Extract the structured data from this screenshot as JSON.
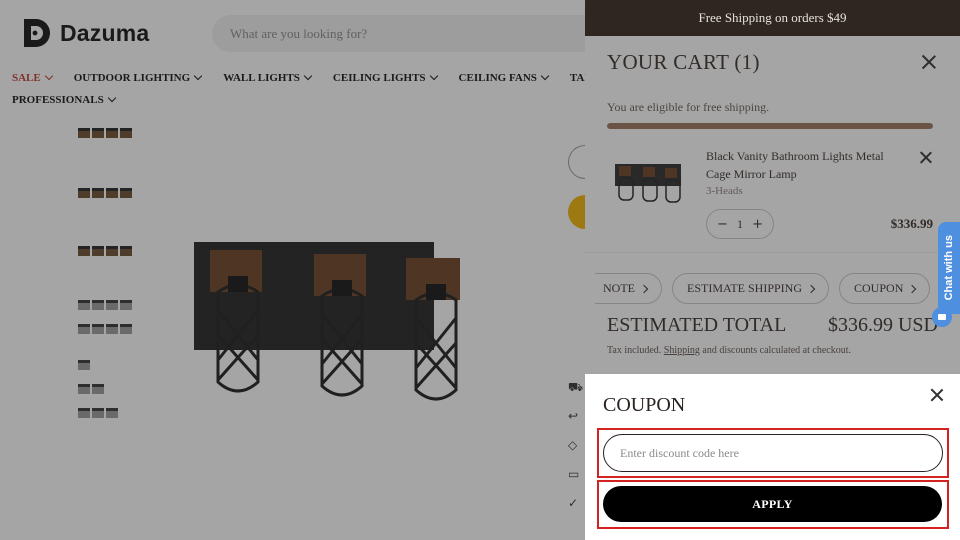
{
  "store": {
    "brand": "Dazuma",
    "search_placeholder": "What are you looking for?",
    "nav": [
      "SALE",
      "OUTDOOR LIGHTING",
      "WALL LIGHTS",
      "CEILING LIGHTS",
      "CEILING FANS",
      "TABLE &",
      "PROFESSIONALS"
    ]
  },
  "cart": {
    "banner": "Free Shipping on orders $49",
    "title": "YOUR CART (1)",
    "free_shipping_msg": "You are eligible for free shipping.",
    "free_shipping_progress": 1.0,
    "item": {
      "name": "Black Vanity Bathroom Lights Metal Cage Mirror Lamp",
      "variant": "3-Heads",
      "quantity": "1",
      "price": "$336.99"
    },
    "pills": [
      "NOTE",
      "ESTIMATE SHIPPING",
      "COUPON"
    ],
    "estimated_total_label": "ESTIMATED TOTAL",
    "estimated_total_value": "$336.99 USD",
    "tax_note_pre": "Tax included.",
    "tax_note_link": "Shipping",
    "tax_note_post": "and discounts calculated at checkout."
  },
  "chat": {
    "label": "Chat with us"
  },
  "coupon": {
    "title": "COUPON",
    "input_placeholder": "Enter discount code here",
    "apply_label": "APPLY"
  },
  "colors": {
    "highlight": "#d32222",
    "banner_bg": "#2f2622",
    "progress": "#9b7458",
    "chat": "#4e8fe0"
  }
}
